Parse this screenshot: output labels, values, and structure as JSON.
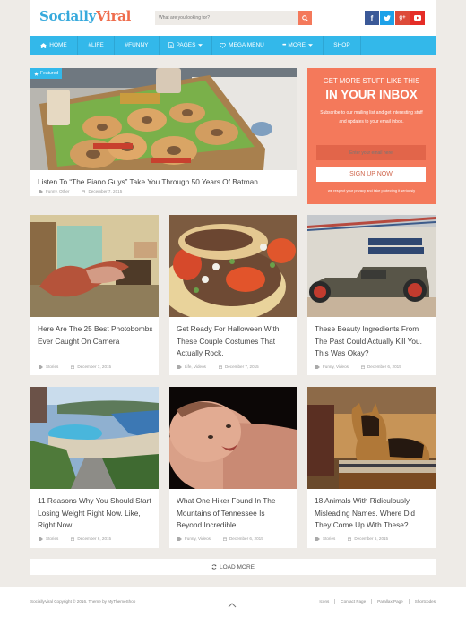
{
  "header": {
    "logo_part1": "Socially",
    "logo_part2": "Viral",
    "search_placeholder": "What are you looking for?",
    "social": [
      {
        "name": "facebook",
        "glyph": "f",
        "color": "#3b5998"
      },
      {
        "name": "twitter",
        "glyph": "t",
        "color": "#1da1f2"
      },
      {
        "name": "google-plus",
        "glyph": "g+",
        "color": "#dd4b39"
      },
      {
        "name": "youtube",
        "glyph": "▶",
        "color": "#e52d27"
      }
    ]
  },
  "nav": {
    "items": [
      {
        "label": "HOME",
        "icon": "home-icon"
      },
      {
        "label": "#LIFE"
      },
      {
        "label": "#FUNNY"
      },
      {
        "label": "PAGES",
        "icon": "page-icon",
        "dropdown": true
      },
      {
        "label": "MEGA MENU",
        "icon": "heart-icon"
      },
      {
        "label": "MORE",
        "icon": "ellipsis-icon",
        "dropdown": true
      },
      {
        "label": "SHOP"
      }
    ],
    "color": "#33b8ea"
  },
  "featured": {
    "badge": "Featured",
    "title": "Listen To “The Piano Guys” Take You Through 50 Years Of Batman",
    "categories": "Funny, Other",
    "date": "December 7, 2015"
  },
  "signup": {
    "line1": "GET MORE STUFF LIKE THIS",
    "line2": "IN YOUR INBOX",
    "description": "Subscribe to our mailing list and get interesting stuff and updates to your email inbox.",
    "email_placeholder": "Enter your email here",
    "button": "SIGN UP NOW",
    "note": "we respect your privacy and take protecting it seriously",
    "color": "#f4795b"
  },
  "posts": [
    {
      "title": "Here Are The 25 Best Photobombs Ever Caught On Camera",
      "categories": "Stories",
      "date": "December 7, 2015",
      "image": "giant crab in dining room"
    },
    {
      "title": "Get Ready For Halloween With These Couple Costumes That Actually Rock.",
      "categories": "Life, Videos",
      "date": "December 7, 2015",
      "image": "tacos close-up"
    },
    {
      "title": "These Beauty Ingredients From The Past Could Actually Kill You. This Was Okay?",
      "categories": "Funny, Videos",
      "date": "December 6, 2015",
      "image": "hot rod car at shop"
    },
    {
      "title": "11 Reasons Why You Should Start Losing Weight Right Now. Like, Right Now.",
      "categories": "Stories",
      "date": "December 6, 2015",
      "image": "resort pool by sea"
    },
    {
      "title": "What One Hiker Found In The Mountains of Tennessee Is Beyond Incredible.",
      "categories": "Funny, Videos",
      "date": "December 6, 2015",
      "image": "smiling baby"
    },
    {
      "title": "18 Animals With Ridiculously Misleading Names. Where Did They Come Up With These?",
      "categories": "Stories",
      "date": "December 6, 2015",
      "image": "german shepherd on bench"
    }
  ],
  "load_more": "LOAD MORE",
  "footer": {
    "copyright": "SociallyViral Copyright © 2016. Theme by MyThemeShop",
    "links": [
      "Icons",
      "Contact Page",
      "Parallax Page",
      "Shortcodes"
    ]
  }
}
